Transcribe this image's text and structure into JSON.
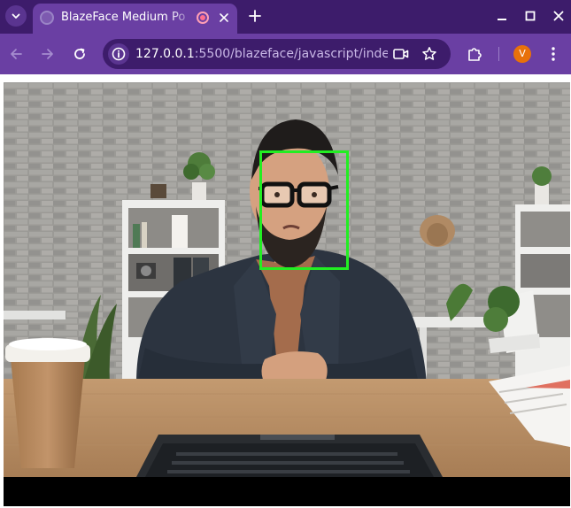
{
  "browser": {
    "tab": {
      "title": "BlazeFace Medium Po",
      "recording": true
    },
    "address_bar": {
      "host": "127.0.0.1",
      "path": ":5500/blazeface/javascript/index...."
    },
    "profile_initial": "V",
    "colors": {
      "tabstrip": "#3d1c6b",
      "toolbar": "#6a3fa3",
      "avatar": "#e8710a"
    },
    "icons": {
      "tab_list": "chevron-down-icon",
      "favicon": "globe-icon",
      "recording": "recording-dot-icon",
      "tab_close": "close-icon",
      "new_tab": "plus-icon",
      "minimize": "minimize-icon",
      "maximize": "maximize-icon",
      "close_window": "close-icon",
      "back": "arrow-left-icon",
      "forward": "arrow-right-icon",
      "reload": "reload-icon",
      "site_info": "info-icon",
      "camera": "video-camera-icon",
      "bookmark": "star-icon",
      "extensions": "puzzle-icon",
      "menu": "kebab-menu-icon"
    }
  },
  "detection": {
    "box_color": "#22ee22"
  }
}
